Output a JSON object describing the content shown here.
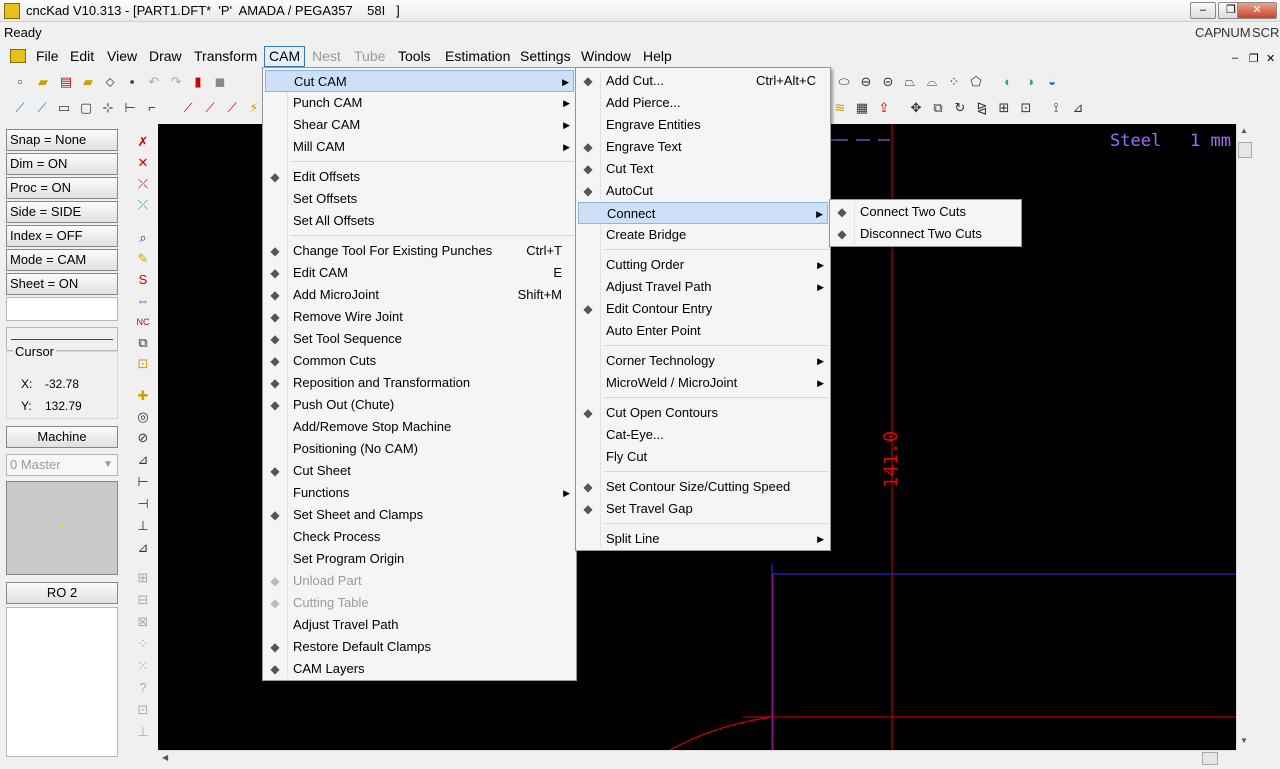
{
  "window": {
    "title": "cncKad V10.313 - [PART1.DFT*  'P'  AMADA / PEGA357    58I   ]",
    "status": "Ready",
    "indicators": [
      "CAP",
      "NUM",
      "SCRL"
    ]
  },
  "menubar": {
    "items": [
      "File",
      "Edit",
      "View",
      "Draw",
      "Transform",
      "CAM",
      "Nest",
      "Tube",
      "Tools",
      "Estimation",
      "Settings",
      "Window",
      "Help"
    ],
    "disabled": [
      "Nest",
      "Tube"
    ],
    "active": "CAM"
  },
  "left_panel": {
    "buttons": [
      "Snap = None",
      "Dim  = ON",
      "Proc  = ON",
      "Side  = SIDE",
      "Index = OFF",
      "Mode = CAM",
      "Sheet = ON"
    ],
    "cursor": {
      "label": "Cursor",
      "x_label": "X:",
      "x_value": "-32.78",
      "y_label": "Y:",
      "y_value": "132.79"
    },
    "machine_button": "Machine",
    "master_combo": "0 Master",
    "ro_button": "RO 2"
  },
  "canvas": {
    "material": "Steel",
    "thickness": "1 mm",
    "dimension_label": "141.0"
  },
  "cam_menu": {
    "items": [
      {
        "label": "Cut CAM",
        "icon": "none",
        "submenu": true,
        "highlighted": true
      },
      {
        "label": "Punch CAM",
        "icon": "none",
        "submenu": true
      },
      {
        "label": "Shear CAM",
        "icon": "none",
        "submenu": true
      },
      {
        "label": "Mill CAM",
        "icon": "none",
        "submenu": true
      },
      {
        "label": "Edit Offsets",
        "icon": "offsets-icon",
        "separator_before": true
      },
      {
        "label": "Set Offsets",
        "icon": "none"
      },
      {
        "label": "Set All Offsets",
        "icon": "none"
      },
      {
        "label": "Change Tool For Existing Punches",
        "icon": "change-tool-icon",
        "shortcut": "Ctrl+T",
        "separator_before": true
      },
      {
        "label": "Edit CAM",
        "icon": "edit-cam-icon",
        "shortcut": "E"
      },
      {
        "label": "Add MicroJoint",
        "icon": "microjoint-icon",
        "shortcut": "Shift+M"
      },
      {
        "label": "Remove Wire Joint",
        "icon": "wire-joint-icon"
      },
      {
        "label": "Set Tool Sequence",
        "icon": "tool-sequence-icon"
      },
      {
        "label": "Common Cuts",
        "icon": "common-cuts-icon"
      },
      {
        "label": "Reposition and Transformation",
        "icon": "reposition-icon"
      },
      {
        "label": "Push Out (Chute)",
        "icon": "push-out-icon"
      },
      {
        "label": "Add/Remove Stop Machine",
        "icon": "none"
      },
      {
        "label": "Positioning (No CAM)",
        "icon": "none"
      },
      {
        "label": "Cut Sheet",
        "icon": "scissors-icon"
      },
      {
        "label": "Functions",
        "icon": "none",
        "submenu": true
      },
      {
        "label": "Set Sheet and Clamps",
        "icon": "clamps-icon"
      },
      {
        "label": "Check Process",
        "icon": "none"
      },
      {
        "label": "Set Program Origin",
        "icon": "none"
      },
      {
        "label": "Unload Part",
        "icon": "unload-icon",
        "disabled": true
      },
      {
        "label": "Cutting Table",
        "icon": "cutting-table-icon",
        "disabled": true
      },
      {
        "label": "Adjust Travel Path",
        "icon": "none"
      },
      {
        "label": "Restore Default Clamps",
        "icon": "restore-clamps-icon"
      },
      {
        "label": "CAM Layers",
        "icon": "layers-icon"
      }
    ]
  },
  "cut_cam_menu": {
    "items": [
      {
        "label": "Add Cut...",
        "icon": "add-cut-icon",
        "shortcut": "Ctrl+Alt+C"
      },
      {
        "label": "Add Pierce...",
        "icon": "none"
      },
      {
        "label": "Engrave Entities",
        "icon": "none"
      },
      {
        "label": "Engrave Text",
        "icon": "engrave-text-icon"
      },
      {
        "label": "Cut Text",
        "icon": "cut-text-icon"
      },
      {
        "label": "AutoCut",
        "icon": "autocut-icon"
      },
      {
        "label": "Connect",
        "icon": "none",
        "submenu": true,
        "highlighted": true
      },
      {
        "label": "Create Bridge",
        "icon": "none"
      },
      {
        "label": "Cutting Order",
        "icon": "none",
        "submenu": true,
        "separator_before": true
      },
      {
        "label": "Adjust Travel Path",
        "icon": "none",
        "submenu": true
      },
      {
        "label": "Edit Contour Entry",
        "icon": "contour-entry-icon"
      },
      {
        "label": "Auto Enter Point",
        "icon": "none"
      },
      {
        "label": "Corner Technology",
        "icon": "none",
        "submenu": true,
        "separator_before": true
      },
      {
        "label": "MicroWeld / MicroJoint",
        "icon": "none",
        "submenu": true
      },
      {
        "label": "Cut Open Contours",
        "icon": "open-contours-icon",
        "separator_before": true
      },
      {
        "label": "Cat-Eye...",
        "icon": "none"
      },
      {
        "label": "Fly Cut",
        "icon": "none"
      },
      {
        "label": "Set Contour Size/Cutting Speed",
        "icon": "contour-size-icon",
        "separator_before": true
      },
      {
        "label": "Set Travel Gap",
        "icon": "travel-gap-icon"
      },
      {
        "label": "Split Line",
        "icon": "none",
        "submenu": true,
        "separator_before": true
      }
    ]
  },
  "connect_menu": {
    "items": [
      {
        "label": "Connect Two Cuts",
        "icon": "connect-icon"
      },
      {
        "label": "Disconnect Two Cuts",
        "icon": "disconnect-icon"
      }
    ]
  }
}
